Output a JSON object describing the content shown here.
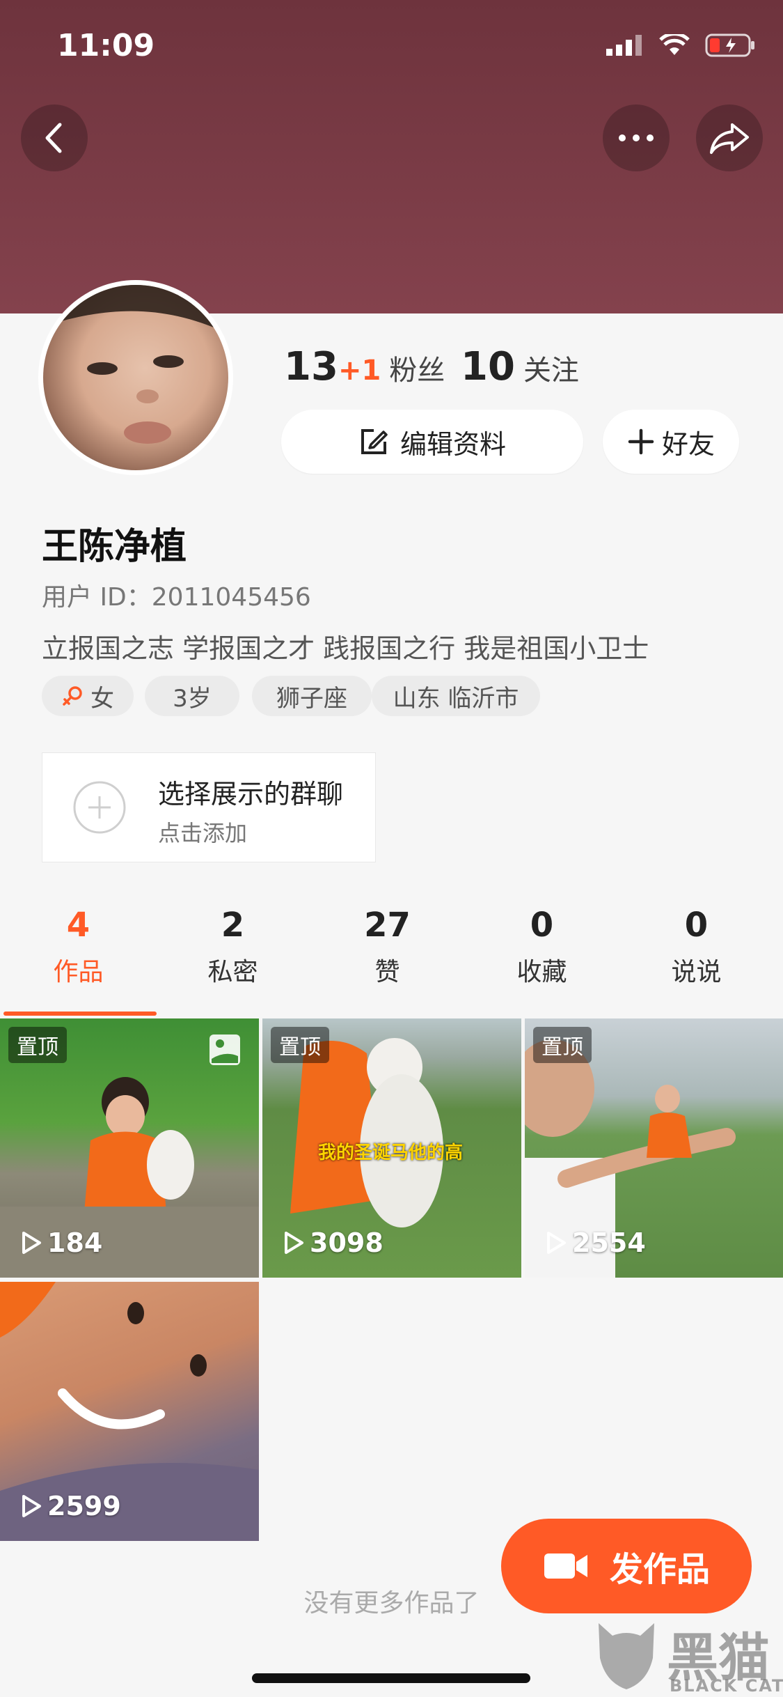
{
  "status_bar": {
    "time": "11:09"
  },
  "profile": {
    "fans_count": "13",
    "fans_delta": "+1",
    "fans_label": "粉丝",
    "following_count": "10",
    "following_label": "关注",
    "edit_label": "编辑资料",
    "friend_label": "好友",
    "name": "王陈净植",
    "user_id": "用户 ID：2011045456",
    "bio": "立报国之志 学报国之才 践报国之行 我是祖国小卫士",
    "tags": [
      "女",
      "3岁",
      "狮子座",
      "山东 临沂市"
    ]
  },
  "group_card": {
    "title": "选择展示的群聊",
    "subtitle": "点击添加"
  },
  "tabs": [
    {
      "count": "4",
      "label": "作品"
    },
    {
      "count": "2",
      "label": "私密"
    },
    {
      "count": "27",
      "label": "赞"
    },
    {
      "count": "0",
      "label": "收藏"
    },
    {
      "count": "0",
      "label": "说说"
    }
  ],
  "works": [
    {
      "pinned": "置顶",
      "plays": "184"
    },
    {
      "pinned": "置顶",
      "plays": "3098",
      "caption": "我的圣诞马他的高"
    },
    {
      "pinned": "置顶",
      "plays": "2554"
    },
    {
      "plays": "2599"
    }
  ],
  "footer": {
    "no_more": "没有更多作品了",
    "publish_label": "发作品"
  },
  "watermark": {
    "cn": "黑猫",
    "en": "BLACK CAT"
  },
  "colors": {
    "accent": "#ff5a26",
    "header": "#7f3c47"
  }
}
